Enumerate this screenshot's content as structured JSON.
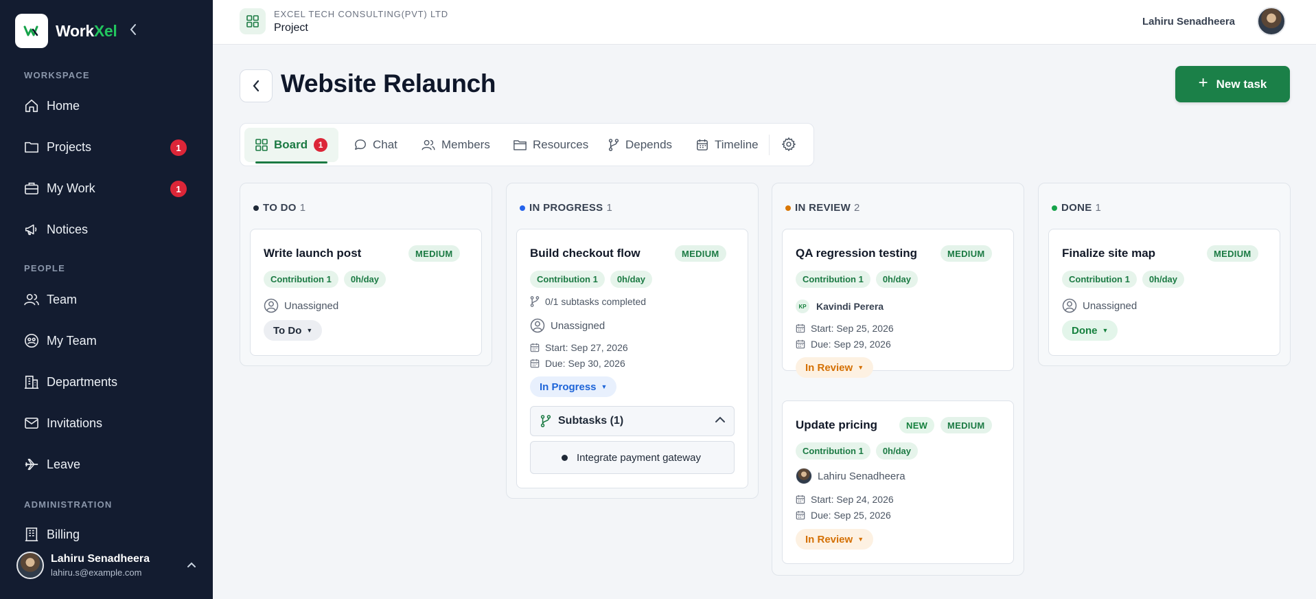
{
  "app": {
    "name_main": "Work",
    "name_accent": "Xel",
    "logo_mark": "W"
  },
  "sidebar": {
    "sections": {
      "workspace": "WORKSPACE",
      "people": "PEOPLE",
      "administration": "ADMINISTRATION"
    },
    "items": [
      {
        "label": "Home",
        "icon": "home-icon"
      },
      {
        "label": "Projects",
        "icon": "folder-icon",
        "badge": "1"
      },
      {
        "label": "My Work",
        "icon": "briefcase-icon",
        "badge": "1"
      },
      {
        "label": "Notices",
        "icon": "megaphone-icon"
      },
      {
        "label": "Team",
        "icon": "users-icon"
      },
      {
        "label": "My Team",
        "icon": "team-icon"
      },
      {
        "label": "Departments",
        "icon": "building-icon"
      },
      {
        "label": "Invitations",
        "icon": "mail-icon"
      },
      {
        "label": "Leave",
        "icon": "plane-icon"
      },
      {
        "label": "Billing",
        "icon": "billing-icon"
      }
    ],
    "user": {
      "name": "Lahiru Senadheera",
      "email": "lahiru.s@example.com"
    }
  },
  "header": {
    "company": "EXCEL TECH CONSULTING(PVT) LTD",
    "section": "Project",
    "user_name": "Lahiru Senadheera"
  },
  "project": {
    "title": "Website Relaunch",
    "new_task_label": "New task"
  },
  "tabs": [
    {
      "label": "Board",
      "badge": "1",
      "active": true
    },
    {
      "label": "Chat"
    },
    {
      "label": "Members"
    },
    {
      "label": "Resources"
    },
    {
      "label": "Depends"
    },
    {
      "label": "Timeline"
    }
  ],
  "colors": {
    "todo": "#1f2937",
    "in_progress": "#2563eb",
    "in_review": "#d97706",
    "done": "#16a34a",
    "accent": "#1b8048"
  },
  "columns": [
    {
      "title": "TO DO",
      "count": "1",
      "cards": [
        {
          "title": "Write launch post",
          "priority": "MEDIUM",
          "contribution": "Contribution 1",
          "rate": "0h/day",
          "assignee": "Unassigned",
          "status": "To Do"
        }
      ]
    },
    {
      "title": "IN PROGRESS",
      "count": "1",
      "cards": [
        {
          "title": "Build checkout flow",
          "priority": "MEDIUM",
          "contribution": "Contribution 1",
          "rate": "0h/day",
          "subtasks_completed": "0/1 subtasks completed",
          "assignee": "Unassigned",
          "start": "Start: Sep 27, 2026",
          "due": "Due: Sep 30, 2026",
          "status": "In Progress",
          "subtasks_label": "Subtasks (1)",
          "subtasks": [
            "Integrate payment gateway"
          ]
        }
      ]
    },
    {
      "title": "IN REVIEW",
      "count": "2",
      "cards": [
        {
          "title": "QA regression testing",
          "priority": "MEDIUM",
          "contribution": "Contribution 1",
          "rate": "0h/day",
          "assignee_initials": "KP",
          "assignee": "Kavindi Perera",
          "start": "Start: Sep 25, 2026",
          "due": "Due: Sep 29, 2026",
          "status": "In Review"
        },
        {
          "title": "Update pricing",
          "tag": "NEW",
          "priority": "MEDIUM",
          "contribution": "Contribution 1",
          "rate": "0h/day",
          "assignee": "Lahiru Senadheera",
          "start": "Start: Sep 24, 2026",
          "due": "Due: Sep 25, 2026",
          "status": "In Review"
        }
      ]
    },
    {
      "title": "DONE",
      "count": "1",
      "cards": [
        {
          "title": "Finalize site map",
          "priority": "MEDIUM",
          "contribution": "Contribution 1",
          "rate": "0h/day",
          "assignee": "Unassigned",
          "status": "Done"
        }
      ]
    }
  ]
}
